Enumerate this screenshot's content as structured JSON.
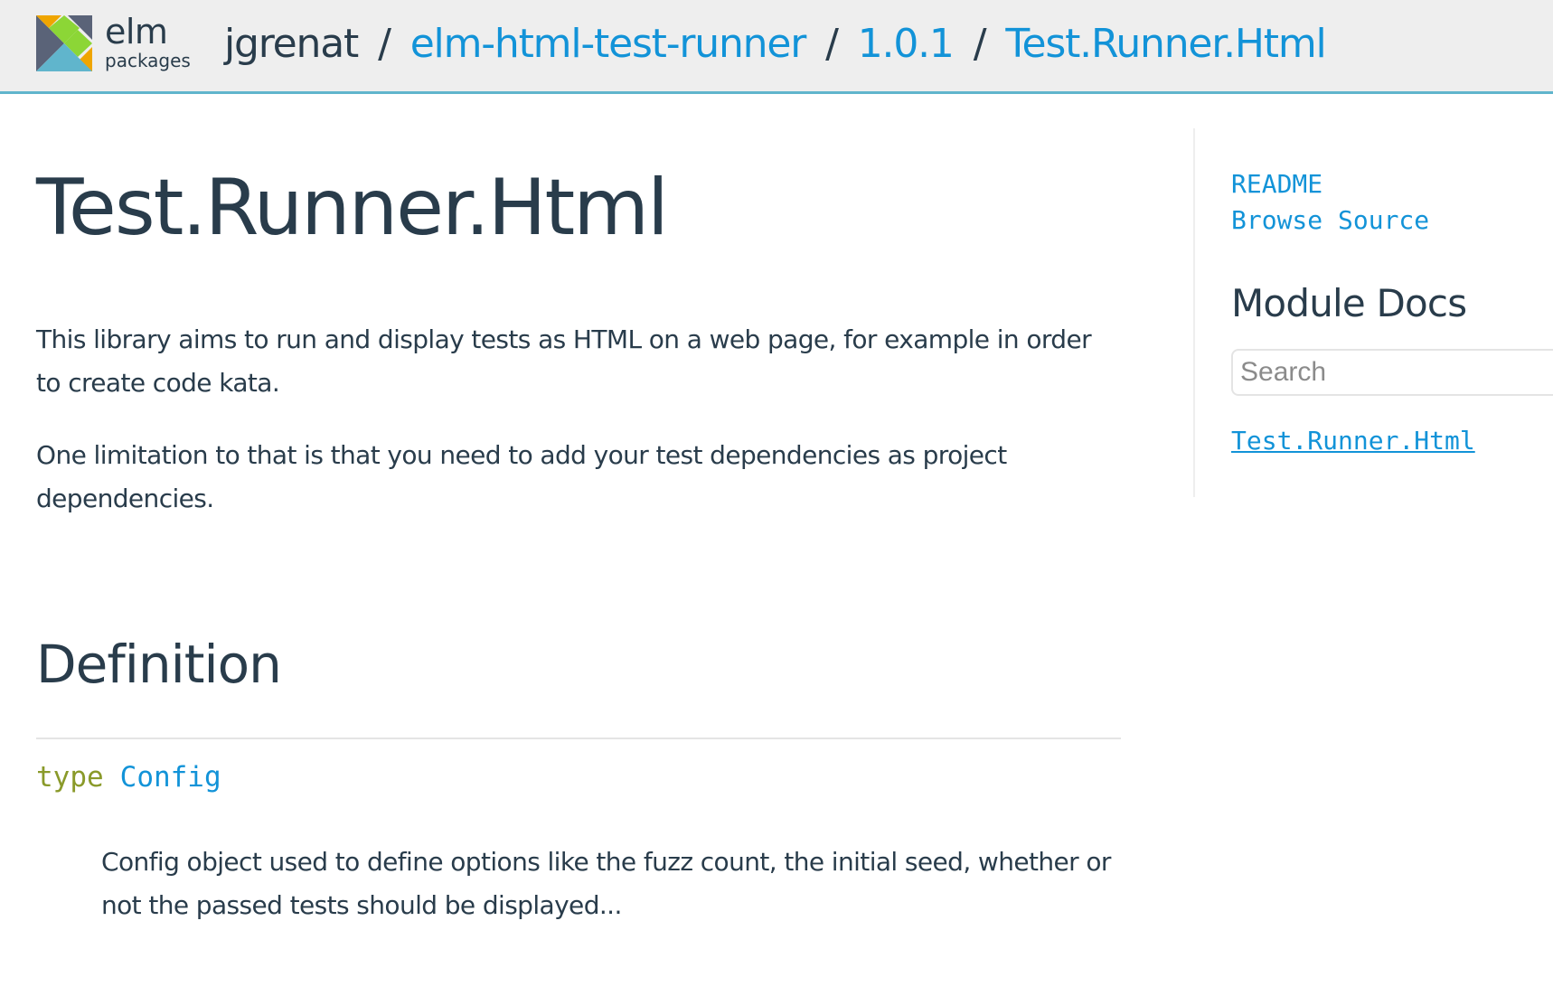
{
  "header": {
    "logo": {
      "name": "elm",
      "sub": "packages"
    },
    "breadcrumbs": [
      {
        "label": "jgrenat"
      },
      {
        "label": "elm-html-test-runner"
      },
      {
        "label": "1.0.1"
      },
      {
        "label": "Test.Runner.Html"
      }
    ],
    "separator": "/"
  },
  "main": {
    "title": "Test.Runner.Html",
    "paragraphs": [
      "This library aims to run and display tests as HTML on a web page, for example in order to create code kata.",
      "One limitation to that is that you need to add your test dependencies as project dependencies."
    ],
    "definition_heading": "Definition",
    "definition": {
      "keyword": "type",
      "name": "Config",
      "description": "Config object used to define options like the fuzz count, the initial seed, whether or not the passed tests should be displayed..."
    }
  },
  "sidebar": {
    "links": [
      "README",
      "Browse Source"
    ],
    "module_docs_title": "Module Docs",
    "search_placeholder": "Search",
    "modules": [
      "Test.Runner.Html"
    ]
  },
  "colors": {
    "link": "#1293d8",
    "text": "#293c4b",
    "keyword": "#8a9a2a",
    "header_bg": "#eeeeee",
    "header_border": "#60b5cc"
  },
  "icons": {
    "logo": "elm-tangram-logo-icon"
  }
}
